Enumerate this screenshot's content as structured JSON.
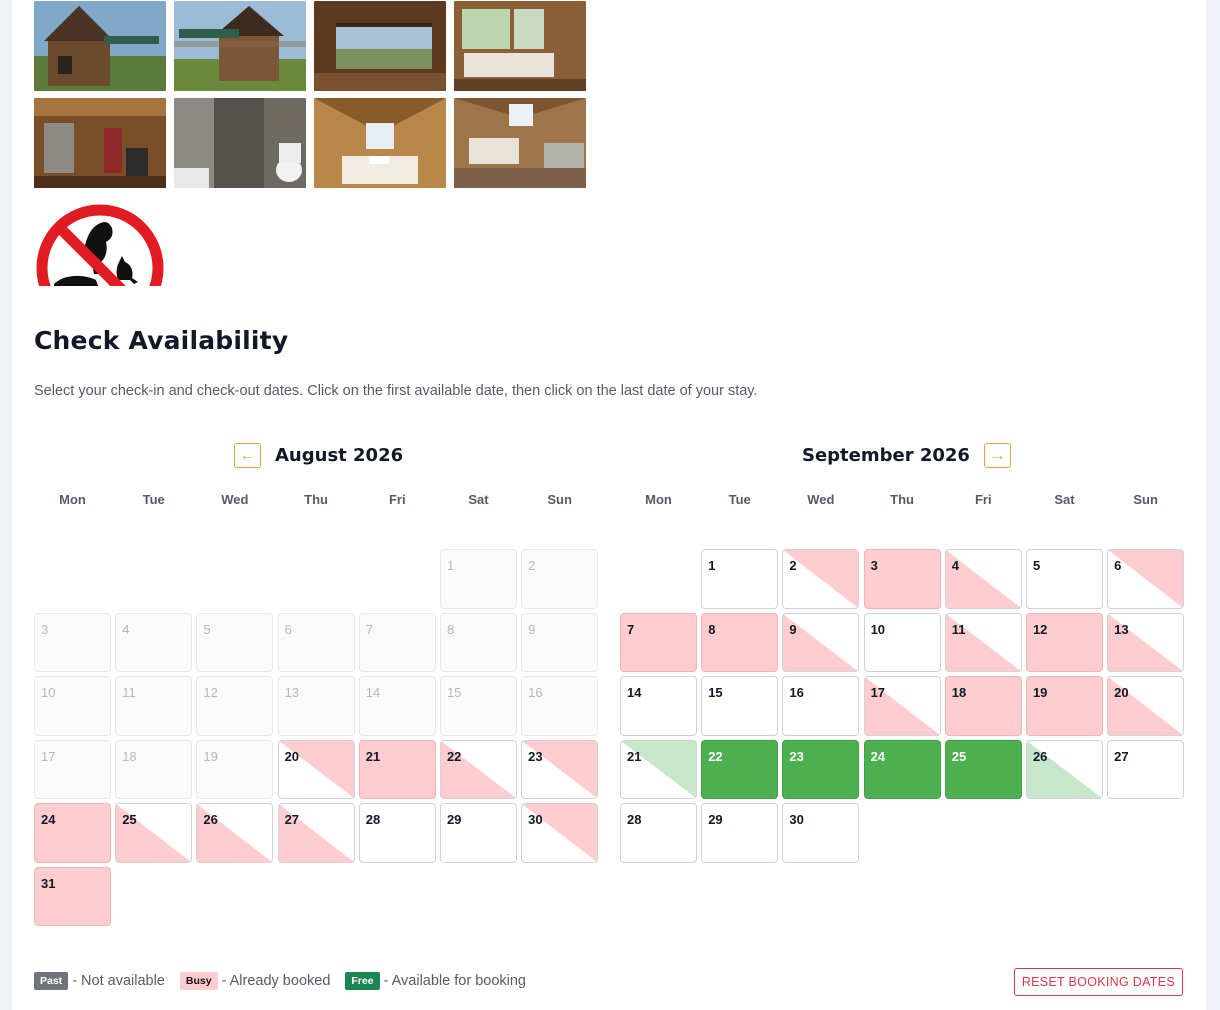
{
  "gallery": {
    "photos": [
      {
        "alt": "cabin-exterior-1"
      },
      {
        "alt": "cabin-exterior-2"
      },
      {
        "alt": "terrace-view"
      },
      {
        "alt": "living-room"
      },
      {
        "alt": "kitchen"
      },
      {
        "alt": "bathroom"
      },
      {
        "alt": "attic-bedroom"
      },
      {
        "alt": "attic-room"
      }
    ],
    "no_pets_icon": "no-pets-icon"
  },
  "availability": {
    "title": "Check Availability",
    "intro": "Select your check-in and check-out dates. Click on the first available date, then click on the last date of your stay."
  },
  "calendar": {
    "prev_icon": "←",
    "next_icon": "→",
    "weekdays": [
      "Mon",
      "Tue",
      "Wed",
      "Thu",
      "Fri",
      "Sat",
      "Sun"
    ],
    "months": [
      {
        "name": "August 2026",
        "offset": 5,
        "days": [
          {
            "d": "1",
            "s": "past"
          },
          {
            "d": "2",
            "s": "past"
          },
          {
            "d": "3",
            "s": "past"
          },
          {
            "d": "4",
            "s": "past"
          },
          {
            "d": "5",
            "s": "past"
          },
          {
            "d": "6",
            "s": "past"
          },
          {
            "d": "7",
            "s": "past"
          },
          {
            "d": "8",
            "s": "past"
          },
          {
            "d": "9",
            "s": "past"
          },
          {
            "d": "10",
            "s": "past"
          },
          {
            "d": "11",
            "s": "past"
          },
          {
            "d": "12",
            "s": "past"
          },
          {
            "d": "13",
            "s": "past"
          },
          {
            "d": "14",
            "s": "past"
          },
          {
            "d": "15",
            "s": "past"
          },
          {
            "d": "16",
            "s": "past"
          },
          {
            "d": "17",
            "s": "past"
          },
          {
            "d": "18",
            "s": "past"
          },
          {
            "d": "19",
            "s": "past"
          },
          {
            "d": "20",
            "s": "half-pink"
          },
          {
            "d": "21",
            "s": "busy"
          },
          {
            "d": "22",
            "s": "half-pink-bl"
          },
          {
            "d": "23",
            "s": "half-pink"
          },
          {
            "d": "24",
            "s": "busy"
          },
          {
            "d": "25",
            "s": "half-pink-bl"
          },
          {
            "d": "26",
            "s": "half-pink-bl"
          },
          {
            "d": "27",
            "s": "half-pink-bl"
          },
          {
            "d": "28",
            "s": "free"
          },
          {
            "d": "29",
            "s": "free"
          },
          {
            "d": "30",
            "s": "half-pink"
          },
          {
            "d": "31",
            "s": "busy"
          }
        ]
      },
      {
        "name": "September 2026",
        "offset": 1,
        "days": [
          {
            "d": "1",
            "s": "free"
          },
          {
            "d": "2",
            "s": "half-pink"
          },
          {
            "d": "3",
            "s": "busy"
          },
          {
            "d": "4",
            "s": "half-pink-bl"
          },
          {
            "d": "5",
            "s": "free"
          },
          {
            "d": "6",
            "s": "half-pink"
          },
          {
            "d": "7",
            "s": "busy"
          },
          {
            "d": "8",
            "s": "busy"
          },
          {
            "d": "9",
            "s": "half-pink-bl"
          },
          {
            "d": "10",
            "s": "free"
          },
          {
            "d": "11",
            "s": "half-pink-bl"
          },
          {
            "d": "12",
            "s": "busy"
          },
          {
            "d": "13",
            "s": "half-pink-bl"
          },
          {
            "d": "14",
            "s": "free"
          },
          {
            "d": "15",
            "s": "free"
          },
          {
            "d": "16",
            "s": "free"
          },
          {
            "d": "17",
            "s": "half-pink-bl"
          },
          {
            "d": "18",
            "s": "busy"
          },
          {
            "d": "19",
            "s": "busy"
          },
          {
            "d": "20",
            "s": "half-pink-bl"
          },
          {
            "d": "21",
            "s": "sel-end"
          },
          {
            "d": "22",
            "s": "sel"
          },
          {
            "d": "23",
            "s": "sel"
          },
          {
            "d": "24",
            "s": "sel"
          },
          {
            "d": "25",
            "s": "sel"
          },
          {
            "d": "26",
            "s": "sel-start"
          },
          {
            "d": "27",
            "s": "free"
          },
          {
            "d": "28",
            "s": "free"
          },
          {
            "d": "29",
            "s": "free"
          },
          {
            "d": "30",
            "s": "free"
          }
        ]
      }
    ]
  },
  "legend": {
    "past_badge": "Past",
    "past_text": "- Not available",
    "busy_badge": "Busy",
    "busy_text": "- Already booked",
    "free_badge": "Free",
    "free_text": "- Available for booking"
  },
  "reset_label": "RESET BOOKING DATES",
  "colors": {
    "busy": "#ffcdd0",
    "selected": "#4caf50",
    "accent": "#e5a23a",
    "danger": "#dc3545"
  }
}
